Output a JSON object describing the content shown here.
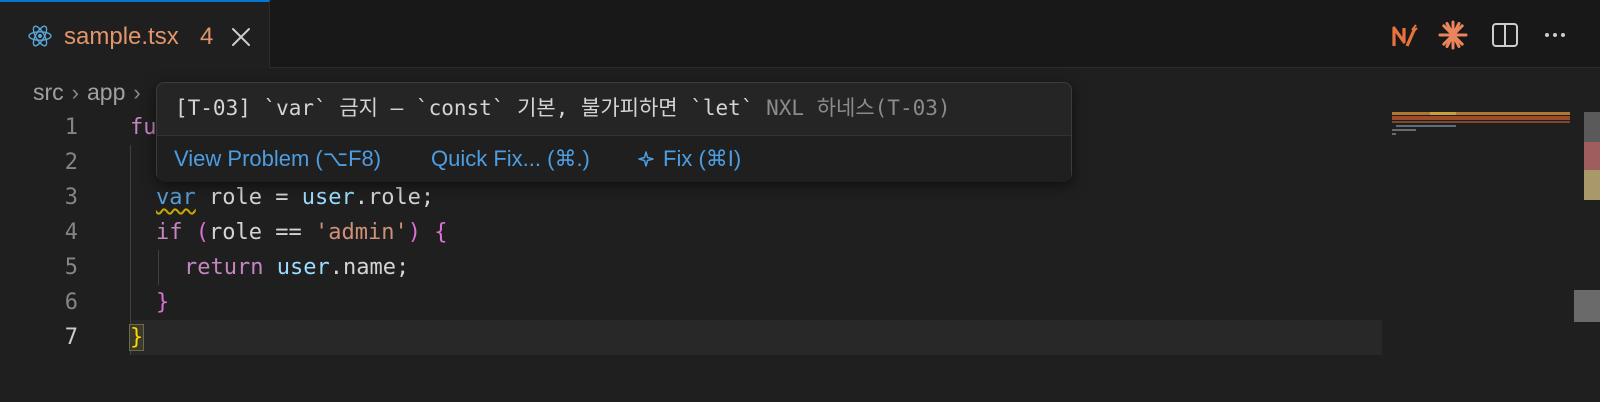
{
  "tab": {
    "filename": "sample.tsx",
    "problem_count": "4",
    "icon": "react-icon",
    "colors": {
      "modified": "#e2956c",
      "active_border": "#0078d4"
    }
  },
  "actions": [
    {
      "icon": "nx-icon"
    },
    {
      "icon": "sparkle-icon"
    },
    {
      "icon": "split-editor-icon"
    },
    {
      "icon": "more-actions-icon"
    }
  ],
  "breadcrumb": {
    "items": [
      "src",
      "app"
    ]
  },
  "editor": {
    "line_numbers": [
      "1",
      "2",
      "3",
      "4",
      "5",
      "6",
      "7"
    ],
    "lines": {
      "l1": [
        "fu"
      ],
      "l3": [
        "var",
        " role = ",
        "user",
        ".role;"
      ],
      "l4": [
        "if",
        " ",
        "(",
        "role == ",
        "'admin'",
        ")",
        " ",
        "{"
      ],
      "l5": [
        "return",
        " ",
        "user",
        ".name;"
      ],
      "l6": [
        "}"
      ],
      "l7": [
        "}"
      ]
    }
  },
  "hover": {
    "message": "[T-03] `var` 금지 — `const` 기본, 불가피하면 `let`",
    "source": "NXL 하네스(T-03)",
    "actions": [
      {
        "label": "View Problem (⌥F8)"
      },
      {
        "label": "Quick Fix... (⌘.)"
      },
      {
        "label": "Fix (⌘I)",
        "icon": "sparkle-fix-icon"
      }
    ]
  },
  "colors": {
    "background": "#1f1f1f",
    "warning": "#cca700",
    "link": "#4d9de0"
  }
}
